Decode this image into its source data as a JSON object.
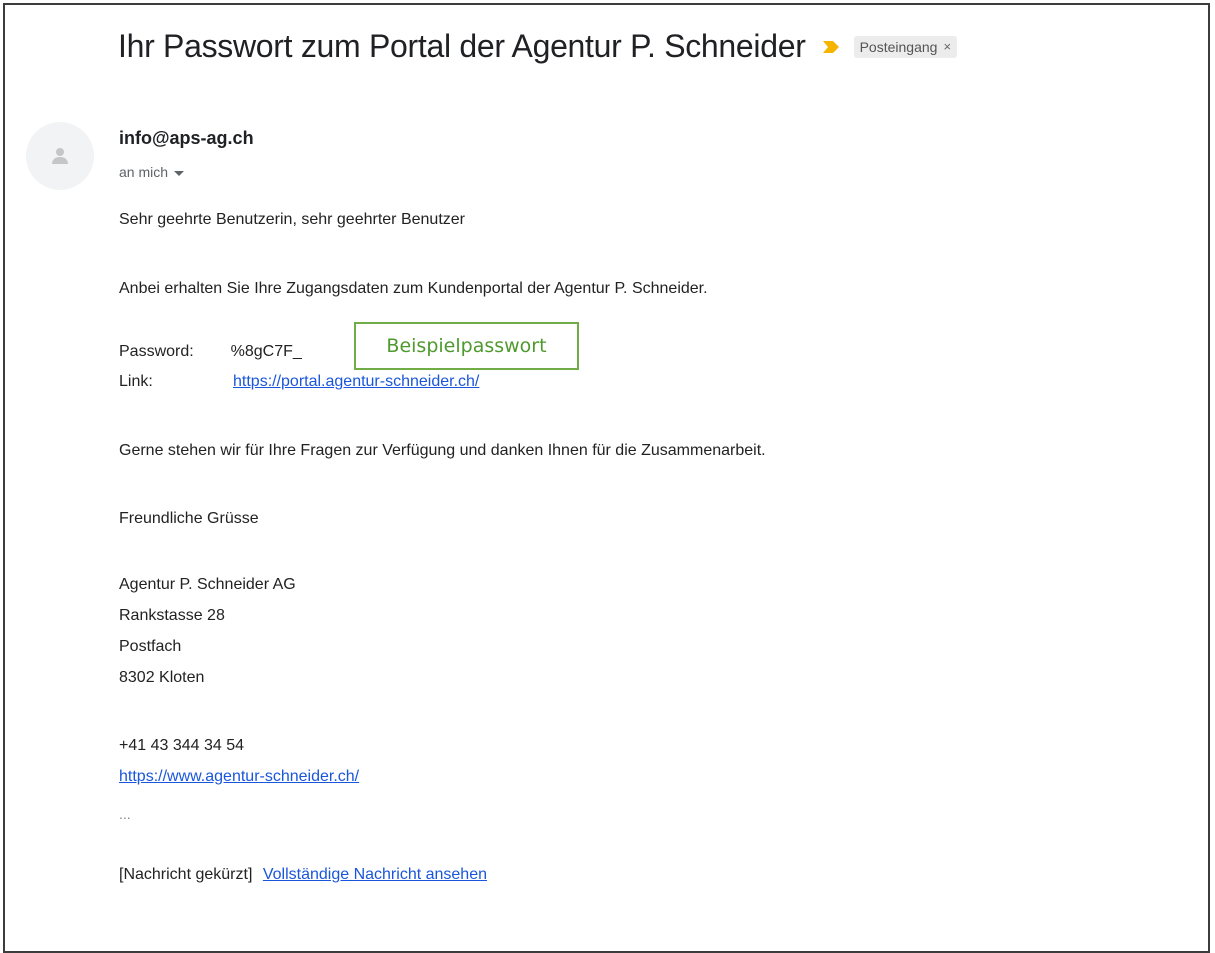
{
  "email": {
    "subject": "Ihr Passwort zum Portal der Agentur P. Schneider",
    "label": "Posteingang",
    "label_close": "×",
    "sender": "info@aps-ag.ch",
    "recipient": "an mich",
    "greeting": "Sehr geehrte Benutzerin, sehr geehrter Benutzer",
    "intro": "Anbei erhalten Sie Ihre Zugangsdaten zum Kundenportal der Agentur P. Schneider.",
    "password_label": "Password:",
    "password_value": "%8gC7F_",
    "link_label": "Link:",
    "portal_link": "https://portal.agentur-schneider.ch/",
    "closing_line": "Gerne stehen wir für Ihre Fragen zur Verfügung und danken Ihnen für die Zusammenarbeit.",
    "regards": "Freundliche Grüsse",
    "signature": {
      "company": "Agentur P. Schneider AG",
      "street": "Rankstasse 28",
      "pobox": "Postfach",
      "city": "8302 Kloten",
      "phone": "+41 43 344 34 54",
      "website": "https://www.agentur-schneider.ch/"
    },
    "ellipsis": "...",
    "truncated_note": "[Nachricht gekürzt]",
    "view_full": "Vollständige Nachricht ansehen"
  },
  "overlay": {
    "caption": "Beispielpasswort"
  },
  "icons": {
    "important": "importance-marker-icon",
    "avatar": "default-avatar-icon"
  },
  "colors": {
    "important_marker": "#f4b400",
    "link": "#1a56db",
    "overlay_border": "#70ad47",
    "overlay_text": "#4e9a2e"
  }
}
